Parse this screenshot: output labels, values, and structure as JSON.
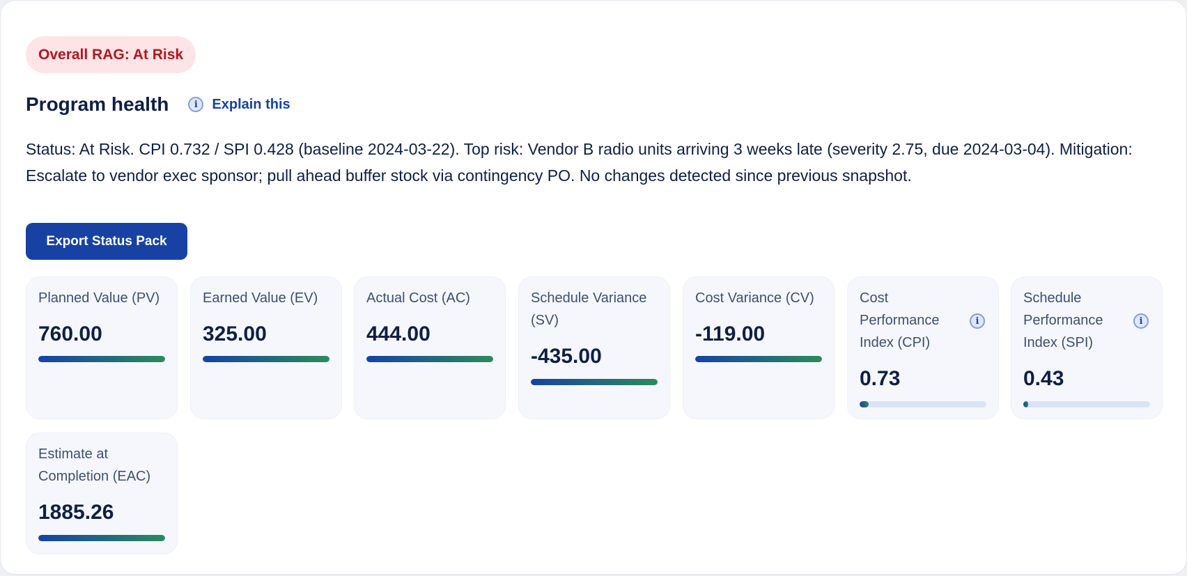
{
  "rag": {
    "label": "Overall RAG: At Risk",
    "color": "#b3171f"
  },
  "health": {
    "title": "Program health",
    "explain_label": "Explain this",
    "explain_icon": "info-icon"
  },
  "status_text": "Status: At Risk. CPI 0.732 / SPI 0.428 (baseline 2024-03-22). Top risk: Vendor B radio units arriving 3 weeks late (severity 2.75, due 2024-03-04). Mitigation: Escalate to vendor exec sponsor; pull ahead buffer stock via contingency PO. No changes detected since previous snapshot.",
  "export_button": "Export Status Pack",
  "metrics": [
    {
      "label": "Planned Value (PV)",
      "value": "760.00",
      "progress": 1.0
    },
    {
      "label": "Earned Value (EV)",
      "value": "325.00",
      "progress": 1.0
    },
    {
      "label": "Actual Cost (AC)",
      "value": "444.00",
      "progress": 1.0
    },
    {
      "label": "Schedule Variance (SV)",
      "value": "-435.00",
      "progress": 1.0
    },
    {
      "label": "Cost Variance (CV)",
      "value": "-119.00",
      "progress": 1.0
    },
    {
      "label": "Cost Performance Index (CPI)",
      "value": "0.73",
      "progress": 0.07,
      "info_icon": "info-icon"
    },
    {
      "label": "Schedule Performance Index (SPI)",
      "value": "0.43",
      "progress": 0.04,
      "info_icon": "info-icon"
    },
    {
      "label": "Estimate at Completion (EAC)",
      "value": "1885.26",
      "progress": 1.0
    }
  ],
  "colors": {
    "accent": "#1742a3",
    "bar_gradient_end": "#2e8a5c",
    "rag_background": "#fde4e6"
  }
}
